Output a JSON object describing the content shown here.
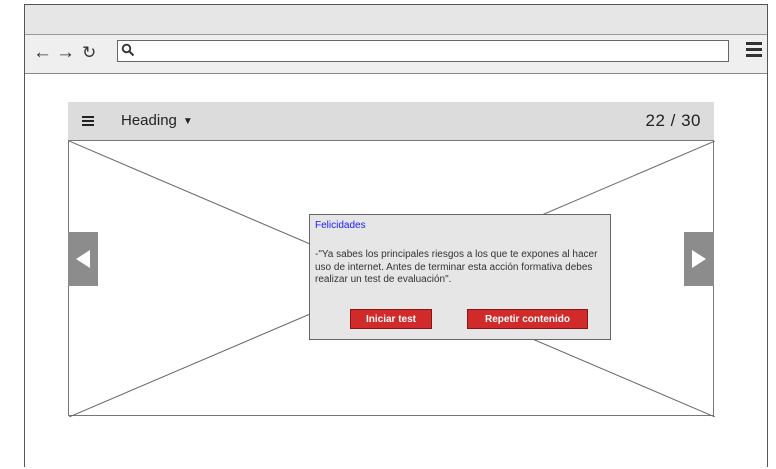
{
  "browser": {
    "back_icon": "back-arrow-icon",
    "forward_icon": "forward-arrow-icon",
    "reload_icon": "reload-icon",
    "search_icon": "search-icon",
    "url_value": "",
    "menu_icon": "menu-icon"
  },
  "viewer": {
    "heading": "Heading",
    "counter": "22 / 30"
  },
  "dialog": {
    "title": "Felicidades",
    "message": "-\"Ya sabes los principales riesgos a los que te expones al hacer uso de internet. Antes de terminar esta acción formativa debes realizar un test de evaluación\".",
    "start_button": "Iniciar test",
    "repeat_button": "Repetir contenido"
  },
  "colors": {
    "button_red": "#d12a2a",
    "title_blue": "#1a1aff",
    "header_gray": "#dcdcdc",
    "dialog_gray": "#e6e6e6"
  }
}
